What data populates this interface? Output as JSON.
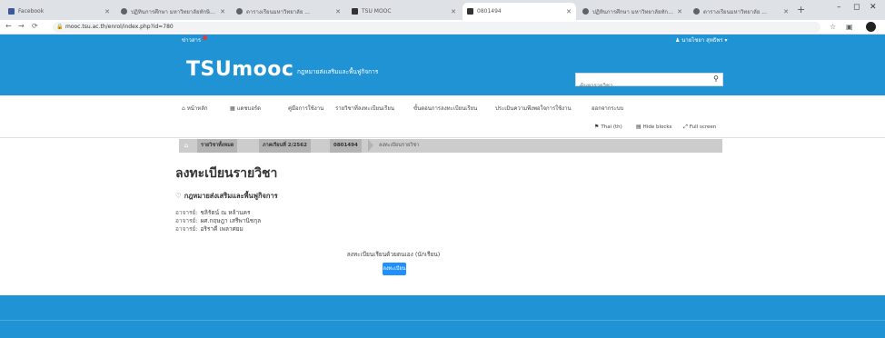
{
  "browser": {
    "tabs": [
      {
        "label": "Facebook",
        "favicon_color": "#3b5998"
      },
      {
        "label": "ปฏิทินการศึกษา มหาวิทยาลัยทักษิณ ...",
        "favicon_color": "#5f6368"
      },
      {
        "label": "ตารางเรียนมหาวิทยาลัย ...",
        "favicon_color": "#5f6368"
      },
      {
        "label": "TSU MOOC",
        "favicon_color": "#333333"
      },
      {
        "label": "0801494",
        "favicon_color": "#333333",
        "active": true
      },
      {
        "label": "ปฏิทินการศึกษา มหาวิทยาลัยทักษิณ ...",
        "favicon_color": "#5f6368"
      },
      {
        "label": "ตารางเรียนมหาวิทยาลัย ...",
        "favicon_color": "#5f6368"
      }
    ],
    "url": "mooc.tsu.ac.th/enrol/index.php?id=780",
    "window_controls": {
      "minimize": "–",
      "maximize": "◻",
      "close": "✕"
    }
  },
  "site": {
    "news_label": "ข่าวสาร",
    "user_label": "นายไชยา สุทธิพร ▾",
    "logo": "TSUmooc",
    "tagline": "กฎหมายส่งเสริมและพื้นฟูกิจการ",
    "search_placeholder": "ค้นหารายวิชา",
    "nav": [
      {
        "label": "หน้าหลัก",
        "icon": "home-icon"
      },
      {
        "label": "แดชบอร์ด",
        "icon": "dashboard-icon"
      },
      {
        "label": "คู่มือการใช้งาน",
        "icon": ""
      },
      {
        "label": "รายวิชาที่ลงทะเบียนเรียน",
        "icon": ""
      },
      {
        "label": "ขั้นตอนการลงทะเบียนเรียน",
        "icon": ""
      },
      {
        "label": "ประเมินความพึงพอใจการใช้งาน",
        "icon": ""
      },
      {
        "label": "ออกจากระบบ",
        "icon": ""
      }
    ],
    "utilities": {
      "language": "Thai (th)",
      "hide_blocks": "Hide blocks",
      "full_screen": "Full screen"
    }
  },
  "breadcrumb": [
    "หน้าหลัก",
    "รายวิชาทั้งหมด",
    "ภาคเรียนที่ 2/2562",
    "0801494",
    "ลงทะเบียนรายวิชา"
  ],
  "main": {
    "title": "ลงทะเบียนรายวิชา",
    "course": "กฎหมายส่งเสริมและพื้นฟูกิจการ",
    "teachers": [
      {
        "label": "อาจารย์:",
        "name": "ชลิรัตน์ ณ หล้านคร"
      },
      {
        "label": "อาจารย์:",
        "name": "ผศ.กฤษฎา เสรีพานิชกุล"
      },
      {
        "label": "อาจารย์:",
        "name": "อริราคี เพลาศยม"
      }
    ],
    "enrol_message": "ลงทะเบียนเรียนด้วยตนเอง (นักเรียน)",
    "enrol_button": "ลงทะเบียน"
  },
  "colors": {
    "brand_blue": "#1f93d3",
    "button_blue": "#1e90ff",
    "breadcrumb_gray": "#cccccc"
  }
}
